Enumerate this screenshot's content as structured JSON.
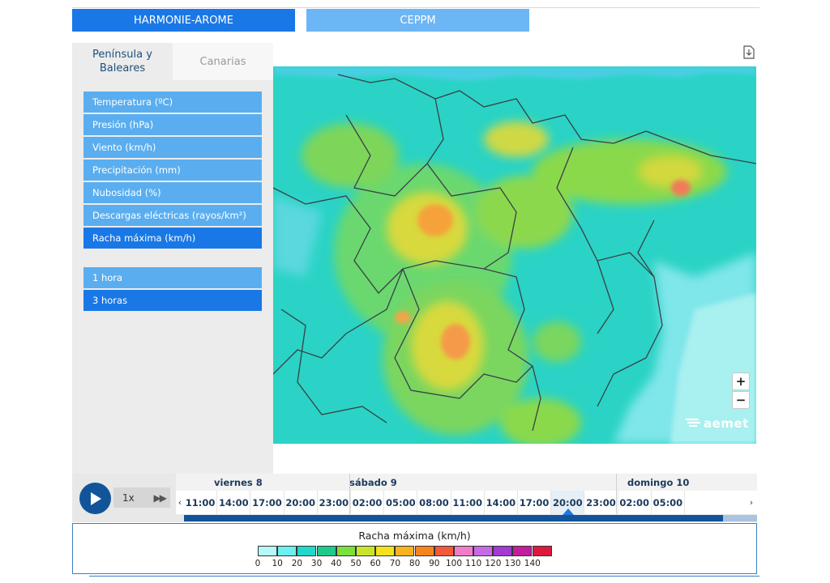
{
  "model_tabs": {
    "harmonie": "HARMONIE-AROME",
    "ceppm": "CEPPM"
  },
  "region_tabs": {
    "peninsula": "Península y Baleares",
    "canarias": "Canarias"
  },
  "variables": [
    {
      "label": "Temperatura (ºC)"
    },
    {
      "label": "Presión (hPa)"
    },
    {
      "label": "Viento (km/h)"
    },
    {
      "label": "Precipitación (mm)"
    },
    {
      "label": "Nubosidad (%)"
    },
    {
      "label": "Descargas eléctricas (rayos/km²)"
    },
    {
      "label": "Racha máxima (km/h)",
      "active": true
    }
  ],
  "time_steps": [
    {
      "label": "1 hora"
    },
    {
      "label": "3 horas",
      "active": true
    }
  ],
  "map": {
    "zoom_in": "+",
    "zoom_out": "−",
    "logo": "aemet",
    "icons": {
      "download": "download-icon",
      "play": "play-icon"
    }
  },
  "player": {
    "speed": "1x",
    "ff": "▶▶"
  },
  "timeline": {
    "days": [
      "viernes 8",
      "sábado 9",
      "domingo 10"
    ],
    "hours": [
      "11:00",
      "14:00",
      "17:00",
      "20:00",
      "23:00",
      "02:00",
      "05:00",
      "08:00",
      "11:00",
      "14:00",
      "17:00",
      "20:00",
      "23:00",
      "02:00",
      "05:00"
    ],
    "active_index": 11,
    "prev": "‹",
    "next": "›",
    "progress": 0.928
  },
  "legend": {
    "title": "Racha máxima (km/h)",
    "ticks": [
      "0",
      "10",
      "20",
      "30",
      "40",
      "50",
      "60",
      "70",
      "80",
      "90",
      "100",
      "110",
      "120",
      "130",
      "140"
    ],
    "colors": [
      "#b7f7f7",
      "#6cf0f0",
      "#21d8cc",
      "#1fc98a",
      "#7be03a",
      "#c9e52b",
      "#f4e21a",
      "#f8b31d",
      "#f5861f",
      "#f25a3b",
      "#f27cc9",
      "#c66be6",
      "#a43ad1",
      "#c21e9e",
      "#dd1a3e"
    ]
  }
}
